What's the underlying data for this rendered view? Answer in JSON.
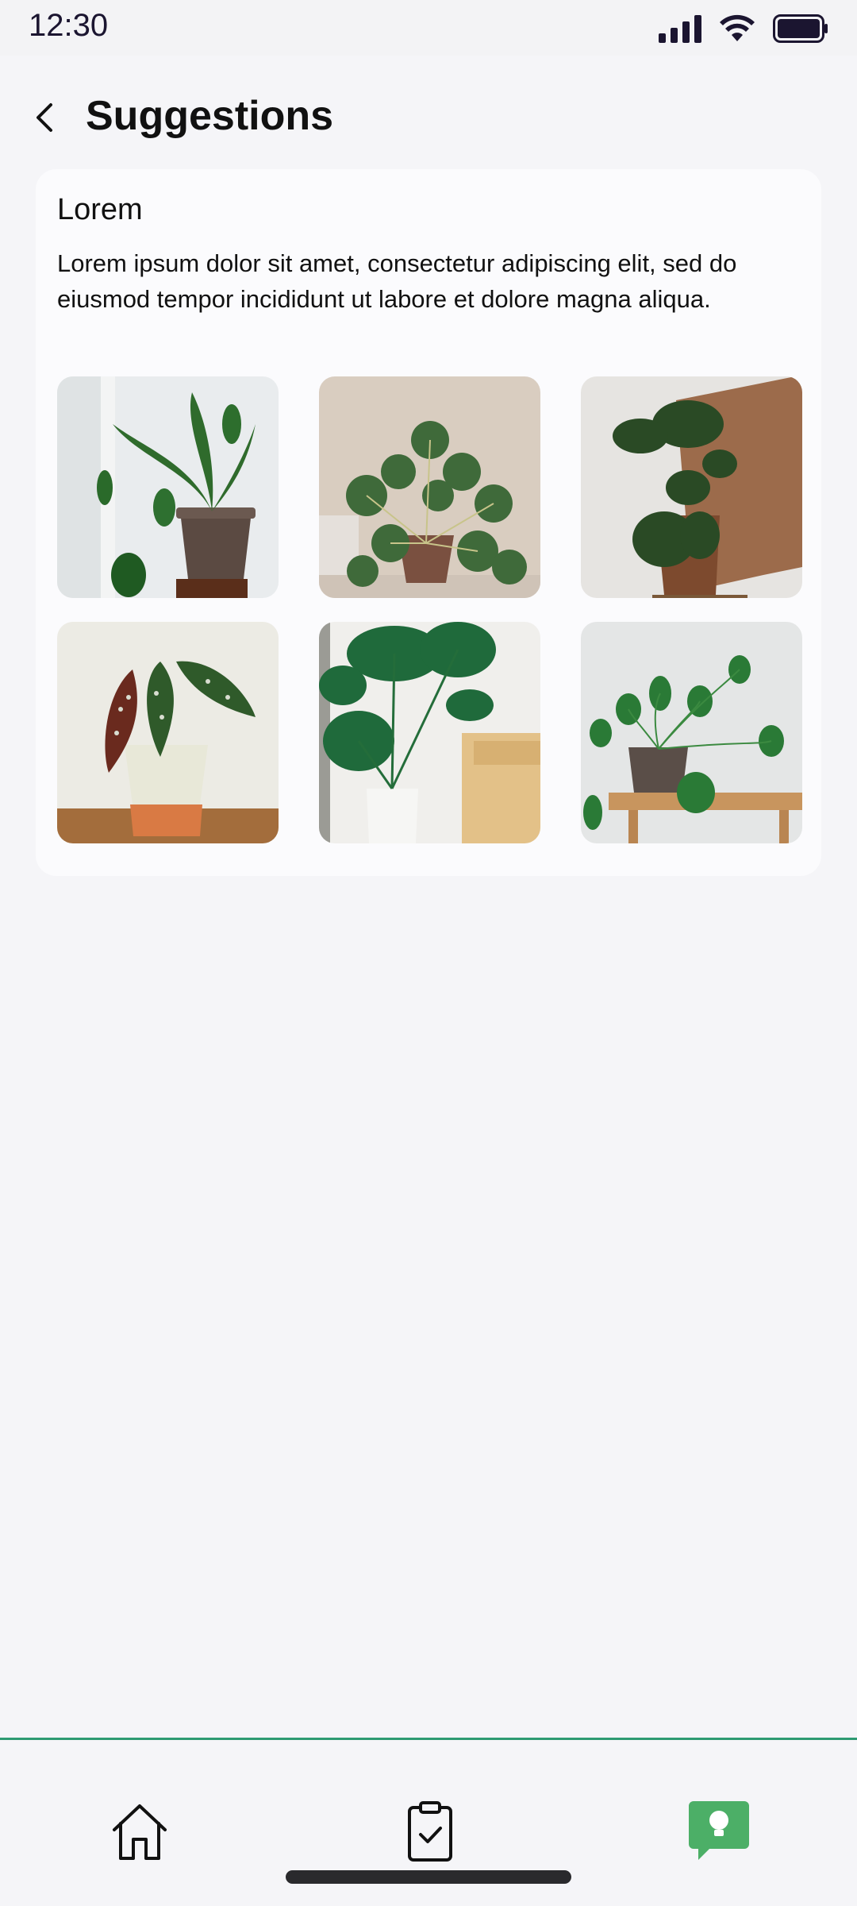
{
  "status_bar": {
    "time": "12:30"
  },
  "header": {
    "title": "Suggestions"
  },
  "card": {
    "title": "Lorem",
    "description": "Lorem ipsum dolor sit amet, consectetur adipiscing elit, sed do eiusmod tempor incididunt ut labore et dolore magna aliqua.",
    "images": [
      "plant-photo-spider-plant",
      "plant-photo-pilea",
      "plant-photo-fiddle-leaf-fig",
      "plant-photo-begonia-maculata",
      "plant-photo-monstera",
      "plant-photo-philodendron"
    ]
  },
  "bottom_nav": {
    "items": [
      "home-icon",
      "tasks-clipboard-icon",
      "suggestions-lightbulb-icon"
    ],
    "active": "suggestions-lightbulb-icon",
    "accent_color": "#4caf67"
  },
  "colors": {
    "background": "#f5f5f8",
    "card": "#fbfbfd",
    "nav_border": "#2e9a72"
  }
}
